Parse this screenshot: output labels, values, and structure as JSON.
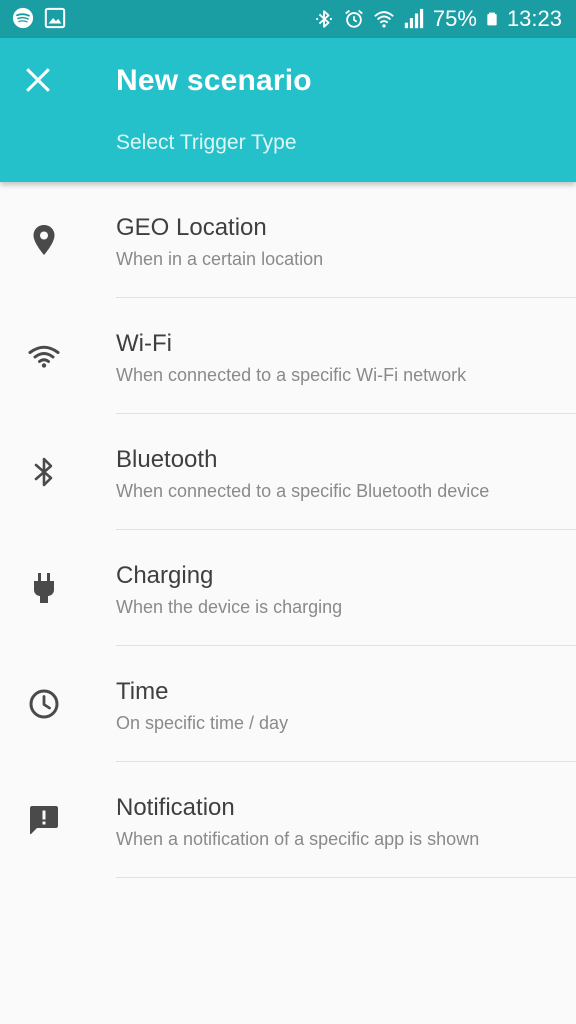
{
  "status_bar": {
    "battery_percent": "75%",
    "time": "13:23",
    "icons_left": [
      "spotify-icon",
      "gallery-icon"
    ],
    "icons_right": [
      "bluetooth-icon",
      "alarm-icon",
      "wifi-icon",
      "signal-icon",
      "battery-icon"
    ]
  },
  "app_bar": {
    "title": "New scenario",
    "subtitle": "Select Trigger Type",
    "close_icon": "close-icon"
  },
  "colors": {
    "status_bar": "#1a9ea4",
    "app_bar": "#24c1ca",
    "background": "#fafafa",
    "title_text": "#3f3f3f",
    "subtitle_text": "#8a8a8a",
    "icon": "#4a4a4a"
  },
  "triggers": [
    {
      "title": "GEO Location",
      "subtitle": "When in a certain location",
      "icon": "location-pin-icon"
    },
    {
      "title": "Wi-Fi",
      "subtitle": "When connected to a specific Wi-Fi network",
      "icon": "wifi-icon"
    },
    {
      "title": "Bluetooth",
      "subtitle": "When connected to a specific Bluetooth device",
      "icon": "bluetooth-icon"
    },
    {
      "title": "Charging",
      "subtitle": "When the device is charging",
      "icon": "power-plug-icon"
    },
    {
      "title": "Time",
      "subtitle": "On specific time / day",
      "icon": "clock-icon"
    },
    {
      "title": "Notification",
      "subtitle": "When a notification of a specific app is shown",
      "icon": "notification-alert-icon"
    }
  ]
}
